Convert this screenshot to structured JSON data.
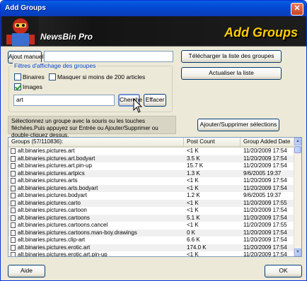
{
  "window": {
    "title": "Add Groups",
    "close_glyph": "✕"
  },
  "banner": {
    "brand": "NewsBin Pro",
    "heading": "Add Groups"
  },
  "toolbar": {
    "manual_add_label": "Ajout manuel",
    "manual_add_value": "",
    "download_list_label": "Télécharger la liste des groupes",
    "update_list_label": "Actualiser la liste",
    "add_remove_label": "Ajouter/Supprimer sélections"
  },
  "filters": {
    "legend": "Filtres d'affichage des groupes",
    "binaries_label": "Binaires",
    "binaries_checked": false,
    "hide_small_label": "Masquer si moins de 200 articles",
    "hide_small_checked": false,
    "images_label": "Images",
    "images_checked": true,
    "search_value": "art",
    "search_button": "Cherche",
    "clear_button": "Effacer"
  },
  "info_text": "Sélectionnez un groupe avec la souris ou les touches fléchées.Puis appuyez sur Entrée ou Ajouter/Supprimer ou double-cliquez dessus.",
  "table": {
    "columns": [
      "Groups (57/110836):",
      "Post Count",
      "Group Added Date"
    ],
    "rows": [
      [
        "alt.binaries.pictures.art",
        "<1 K",
        "11/20/2009 17:54"
      ],
      [
        "alt.binaries.pictures.art.bodyart",
        "3.5 K",
        "11/20/2009 17:54"
      ],
      [
        "alt.binaries.pictures.art.pin-up",
        "15.7 K",
        "11/20/2009 17:54"
      ],
      [
        "alt.binaries.pictures.artpics",
        "1.3 K",
        "9/6/2005 19:37"
      ],
      [
        "alt.binaries.pictures.arts",
        "<1 K",
        "11/20/2009 17:54"
      ],
      [
        "alt.binaries.pictures.arts.bodyart",
        "<1 K",
        "11/20/2009 17:54"
      ],
      [
        "alt.binaries.pictures.bodyart",
        "1.2 K",
        "9/6/2005 19:37"
      ],
      [
        "alt.binaries.pictures.carto",
        "<1 K",
        "11/20/2009 17:55"
      ],
      [
        "alt.binaries.pictures.cartoon",
        "<1 K",
        "11/20/2009 17:54"
      ],
      [
        "alt.binaries.pictures.cartoons",
        "5.1 K",
        "11/20/2009 17:54"
      ],
      [
        "alt.binaries.pictures.cartoons.cancel",
        "<1 K",
        "11/20/2009 17:55"
      ],
      [
        "alt.binaries.pictures.cartoons.man-boy.drawings",
        "0 K",
        "11/20/2009 17:54"
      ],
      [
        "alt.binaries.pictures.clip-art",
        "6.6 K",
        "11/20/2009 17:54"
      ],
      [
        "alt.binaries.pictures.erotic.art",
        "174.0 K",
        "11/20/2009 17:54"
      ],
      [
        "alt.binaries.pictures.erotic.art.pin-up",
        "<1 K",
        "11/20/2009 17:54"
      ]
    ]
  },
  "footer": {
    "help_label": "Aide",
    "ok_label": "OK"
  },
  "colors": {
    "titlebar": "#0249d6",
    "dialog_bg": "#ece9d8",
    "banner_heading": "#ffcc00",
    "legend_text": "#0046d5"
  },
  "icons": {
    "close": "close-icon",
    "group_row": "document-icon",
    "cursor": "mouse-pointer-icon"
  }
}
